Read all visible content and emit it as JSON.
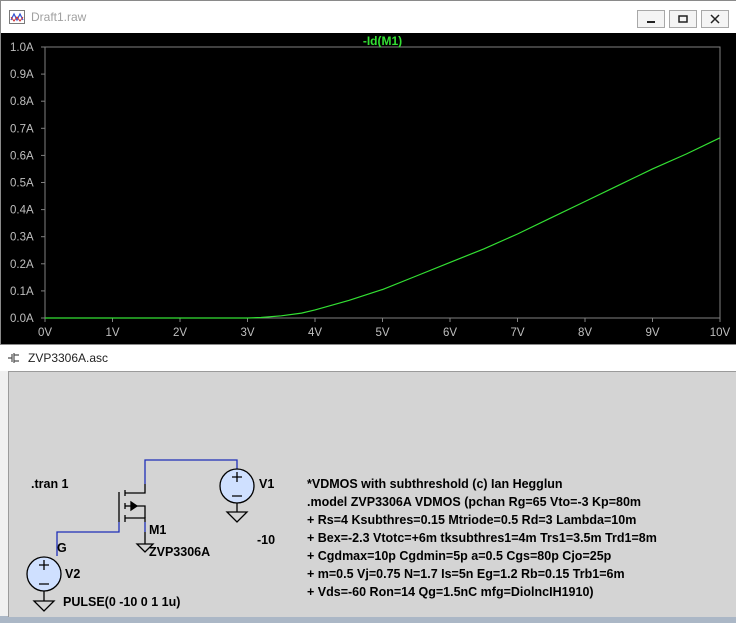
{
  "top_window": {
    "title": "Draft1.raw",
    "buttons": {
      "minimize": "minimize",
      "restore": "restore",
      "close": "close"
    }
  },
  "chart_data": {
    "type": "line",
    "title": "-Id(M1)",
    "xlabel": "",
    "ylabel": "",
    "xlim": [
      0,
      10
    ],
    "ylim": [
      0,
      1.0
    ],
    "x_ticks": [
      "0V",
      "1V",
      "2V",
      "3V",
      "4V",
      "5V",
      "6V",
      "7V",
      "8V",
      "9V",
      "10V"
    ],
    "y_ticks": [
      "0.0A",
      "0.1A",
      "0.2A",
      "0.3A",
      "0.4A",
      "0.5A",
      "0.6A",
      "0.7A",
      "0.8A",
      "0.9A",
      "1.0A"
    ],
    "series": [
      {
        "name": "-Id(M1)",
        "color": "#33e033",
        "x": [
          0,
          1,
          2,
          3,
          3.2,
          3.5,
          3.8,
          4.0,
          4.5,
          5.0,
          5.5,
          6.0,
          6.5,
          7.0,
          7.5,
          8.0,
          8.5,
          9.0,
          9.5,
          10.0
        ],
        "y": [
          0,
          0,
          0,
          0,
          0.002,
          0.008,
          0.018,
          0.03,
          0.065,
          0.105,
          0.155,
          0.205,
          0.255,
          0.31,
          0.37,
          0.43,
          0.49,
          0.55,
          0.605,
          0.665
        ]
      }
    ],
    "grid": false,
    "background": "#000000",
    "axis_color": "#808080"
  },
  "bottom_window": {
    "title": "ZVP3306A.asc",
    "schematic": {
      "tran": ".tran 1",
      "node_g": "G",
      "v1_name": "V1",
      "v1_value": "-10",
      "m1_name": "M1",
      "m1_model": "ZVP3306A",
      "v2_name": "V2",
      "v2_value": "PULSE(0 -10 0 1 1u)",
      "wire_color": "#1f2fb8",
      "model_lines": [
        "*VDMOS with subthreshold (c) Ian Hegglun",
        ".model ZVP3306A VDMOS (pchan Rg=65 Vto=-3 Kp=80m",
        "+ Rs=4 Ksubthres=0.15 Mtriode=0.5 Rd=3 Lambda=10m",
        "+ Bex=-2.3 Vtotc=+6m tksubthres1=4m Trs1=3.5m Trd1=8m",
        "+ Cgdmax=10p Cgdmin=5p a=0.5 Cgs=80p Cjo=25p",
        "+ m=0.5 Vj=0.75 N=1.7 Is=5n Eg=1.2 Rb=0.15 Trb1=6m",
        "+ Vds=-60 Ron=14 Qg=1.5nC mfg=DiolncIH1910)"
      ]
    }
  }
}
